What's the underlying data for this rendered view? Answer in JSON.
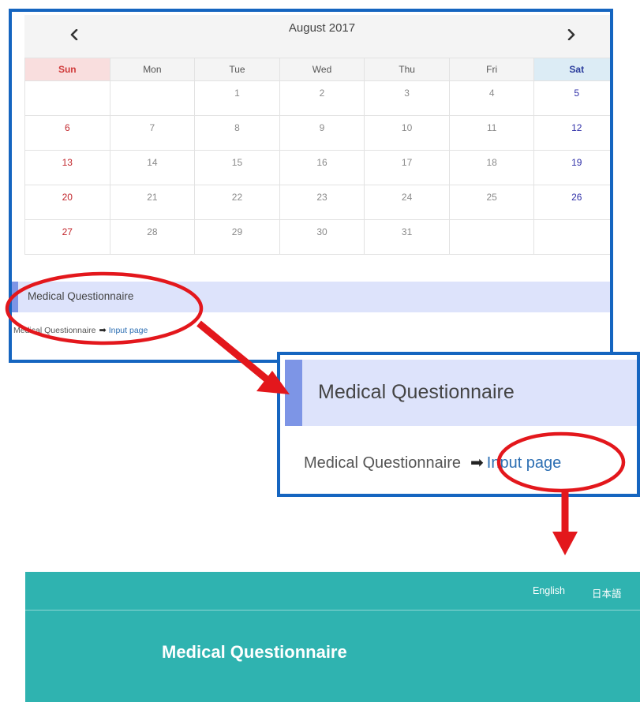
{
  "calendar": {
    "title": "August 2017",
    "weekdays": [
      "Sun",
      "Mon",
      "Tue",
      "Wed",
      "Thu",
      "Fri",
      "Sat"
    ],
    "weeks": [
      [
        "",
        "",
        "1",
        "2",
        "3",
        "4",
        "5"
      ],
      [
        "6",
        "7",
        "8",
        "9",
        "10",
        "11",
        "12"
      ],
      [
        "13",
        "14",
        "15",
        "16",
        "17",
        "18",
        "19"
      ],
      [
        "20",
        "21",
        "22",
        "23",
        "24",
        "25",
        "26"
      ],
      [
        "27",
        "28",
        "29",
        "30",
        "31",
        "",
        ""
      ]
    ],
    "prev_icon": "chevron-left-icon",
    "next_icon": "chevron-right-icon"
  },
  "section": {
    "title": "Medical Questionnaire",
    "link_prefix": "Medical Questionnaire",
    "arrow_icon": "right-arrow-icon",
    "link_label": "Input page"
  },
  "app_header": {
    "languages": [
      "English",
      "日本語"
    ],
    "title": "Medical Questionnaire"
  },
  "colors": {
    "frame_border": "#1565c0",
    "annotation_red": "#e3171c",
    "section_bar": "#dde3fb",
    "section_accent": "#7d95e6",
    "link": "#2d6fb3",
    "teal_header": "#2fb3b0",
    "sunday": "#c2272d",
    "saturday": "#2f2fa8"
  }
}
